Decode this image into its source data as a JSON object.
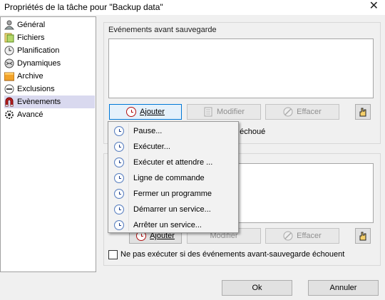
{
  "window": {
    "title": "Propriétés de la tâche pour \"Backup data\"",
    "close_glyph": "✕"
  },
  "sidebar": {
    "items": [
      {
        "label": "Général",
        "icon": "user-icon"
      },
      {
        "label": "Fichiers",
        "icon": "files-icon"
      },
      {
        "label": "Planification",
        "icon": "clock-icon"
      },
      {
        "label": "Dynamiques",
        "icon": "globe-icon"
      },
      {
        "label": "Archive",
        "icon": "archive-icon"
      },
      {
        "label": "Exclusions",
        "icon": "minus-icon"
      },
      {
        "label": "Evènements",
        "icon": "magnet-icon",
        "selected": true
      },
      {
        "label": "Avancé",
        "icon": "gear-icon"
      }
    ]
  },
  "before_group": {
    "label": "Evénements avant sauvegarde",
    "add_label": "Ajouter",
    "modify_label": "Modifier",
    "delete_label": "Effacer",
    "checkbox_partial": "a échoué"
  },
  "after_group": {
    "add_label": "Ajouter",
    "modify_label": "Modifier",
    "delete_label": "Effacer",
    "checkbox_label": "Ne pas exécuter si des événements avant-sauvegarde échouent"
  },
  "menu": {
    "items": [
      "Pause...",
      "Exécuter...",
      "Exécuter et attendre ...",
      "Ligne de commande",
      "Fermer un programme",
      "Démarrer un service...",
      "Arrêter un service..."
    ]
  },
  "footer": {
    "ok_label": "Ok",
    "cancel_label": "Annuler"
  },
  "colors": {
    "selected_bg": "#d9d9ef",
    "focus_border": "#0078d7",
    "window_bg": "#f0f0f0"
  }
}
